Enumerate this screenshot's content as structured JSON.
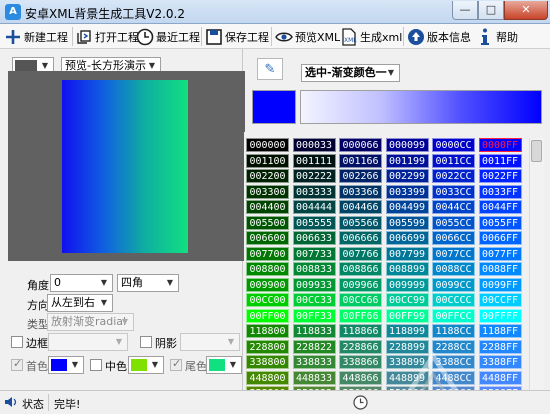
{
  "window": {
    "title": "安卓XML背景生成工具V2.0.2",
    "app_icon_glyph": "A",
    "minimize": "—",
    "maximize": "□",
    "close": "✕"
  },
  "toolbar": {
    "new_project": "新建工程",
    "open_project": "打开工程",
    "recent_project": "最近工程",
    "save_project": "保存工程",
    "preview_xml": "预览XML",
    "generate_xml": "生成xml",
    "version_info": "版本信息",
    "help": "帮助"
  },
  "preview": {
    "mode": "预览-长方形演示",
    "gradient_colors": [
      "#1010f0",
      "#1060e0",
      "#10b0a0",
      "#10e080"
    ]
  },
  "settings": {
    "angle_label": "角度",
    "angle_value": "0",
    "corner_value": "四角",
    "direction_label": "方向",
    "direction_value": "从左到右",
    "type_label": "类型",
    "type_value": "放射渐变radial",
    "border_label": "边框",
    "border_checked": false,
    "shadow_label": "阴影",
    "shadow_checked": false,
    "start_color_label": "首色",
    "start_color_checked": true,
    "start_color": "#0000ff",
    "mid_color_label": "中色",
    "mid_color_checked": false,
    "mid_color": "#80e000",
    "end_color_label": "尾色",
    "end_color_checked": true,
    "end_color": "#10e080"
  },
  "color_picker": {
    "mode": "选中-渐变颜色一",
    "selected_color": "#0000ff",
    "bar_colors": [
      "#f4f4ff",
      "#c0c0ff",
      "#5050ff",
      "#0000ff"
    ]
  },
  "palette": {
    "rows": [
      [
        "000000",
        "000033",
        "000066",
        "000099",
        "0000CC",
        "0000FF"
      ],
      [
        "001100",
        "001111",
        "001166",
        "001199",
        "0011CC",
        "0011FF"
      ],
      [
        "002200",
        "002222",
        "002266",
        "002299",
        "0022CC",
        "0022FF"
      ],
      [
        "003300",
        "003333",
        "003366",
        "003399",
        "0033CC",
        "0033FF"
      ],
      [
        "004400",
        "004444",
        "004466",
        "004499",
        "0044CC",
        "0044FF"
      ],
      [
        "005500",
        "005555",
        "005566",
        "005599",
        "0055CC",
        "0055FF"
      ],
      [
        "006600",
        "006633",
        "006666",
        "006699",
        "0066CC",
        "0066FF"
      ],
      [
        "007700",
        "007733",
        "007766",
        "007799",
        "0077CC",
        "0077FF"
      ],
      [
        "008800",
        "008833",
        "008866",
        "008899",
        "0088CC",
        "0088FF"
      ],
      [
        "009900",
        "009933",
        "009966",
        "009999",
        "0099CC",
        "0099FF"
      ],
      [
        "00CC00",
        "00CC33",
        "00CC66",
        "00CC99",
        "00CCCC",
        "00CCFF"
      ],
      [
        "00FF00",
        "00FF33",
        "00FF66",
        "00FF99",
        "00FFCC",
        "00FFFF"
      ],
      [
        "118800",
        "118833",
        "118866",
        "118899",
        "1188CC",
        "1188FF"
      ],
      [
        "228800",
        "228822",
        "228866",
        "228899",
        "2288CC",
        "2288FF"
      ],
      [
        "338800",
        "338833",
        "338866",
        "338899",
        "3388CC",
        "3388FF"
      ],
      [
        "448800",
        "448833",
        "448866",
        "448899",
        "4488CC",
        "4488FF"
      ],
      [
        "558800",
        "558833",
        "558866",
        "558899",
        "5588CC",
        "5588FF"
      ]
    ],
    "selected": "0000FF"
  },
  "status": {
    "label": "状态",
    "message": "完毕!"
  }
}
